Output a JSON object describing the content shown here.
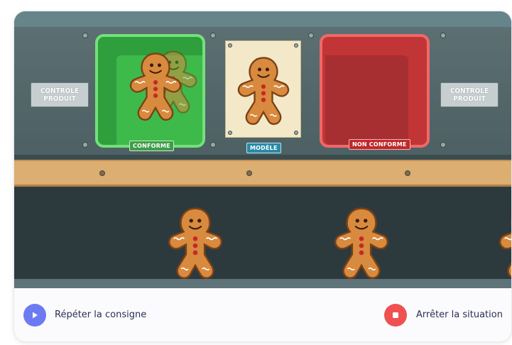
{
  "plates": {
    "left": "CONTRÔLE PRODUIT",
    "right": "CONTRÔLE PRODUIT"
  },
  "bins": {
    "accept_label": "CONFORME",
    "model_label": "MODÈLE",
    "reject_label": "NON CONFORME"
  },
  "footer": {
    "repeat_label": "Répéter la consigne",
    "stop_label": "Arrêter la situation"
  },
  "icons": {
    "repeat": "play-icon",
    "stop": "stop-icon",
    "cookie": "gingerbread-man-icon"
  },
  "colors": {
    "accept": "#2e9f3c",
    "reject": "#c23536",
    "model_tag": "#2a8aa7",
    "repeat_button": "#6c7bf2",
    "stop_button": "#ef5151"
  }
}
